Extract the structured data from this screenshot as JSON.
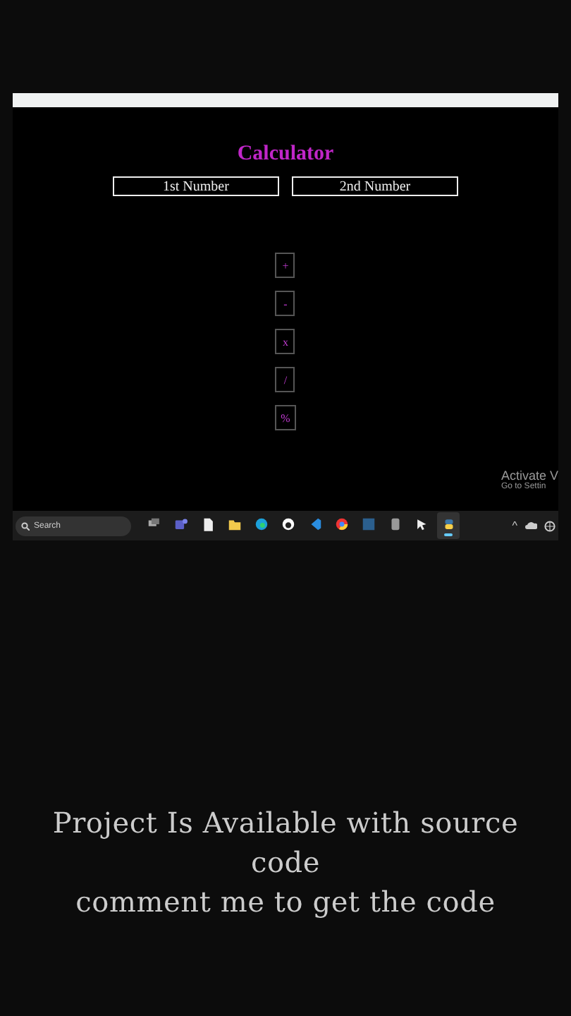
{
  "calculator": {
    "title": "Calculator",
    "fields": [
      {
        "placeholder": "1st Number"
      },
      {
        "placeholder": "2nd Number"
      }
    ],
    "operators": [
      "+",
      "-",
      "x",
      "/",
      "%"
    ]
  },
  "watermark": {
    "title": "Activate V",
    "subtitle": "Go to Settin"
  },
  "taskbar": {
    "search": {
      "placeholder": "Search"
    },
    "apps": [
      {
        "selected": false
      },
      {
        "selected": false
      },
      {
        "selected": false
      },
      {
        "selected": false
      },
      {
        "selected": false
      },
      {
        "selected": false
      },
      {
        "selected": false
      },
      {
        "selected": false
      },
      {
        "selected": false
      },
      {
        "selected": false
      },
      {
        "selected": false
      },
      {
        "selected": true
      }
    ],
    "tray": {
      "caret": "^"
    }
  },
  "caption": {
    "lines": [
      "Project Is Available with source code",
      "comment me to get the code"
    ]
  }
}
